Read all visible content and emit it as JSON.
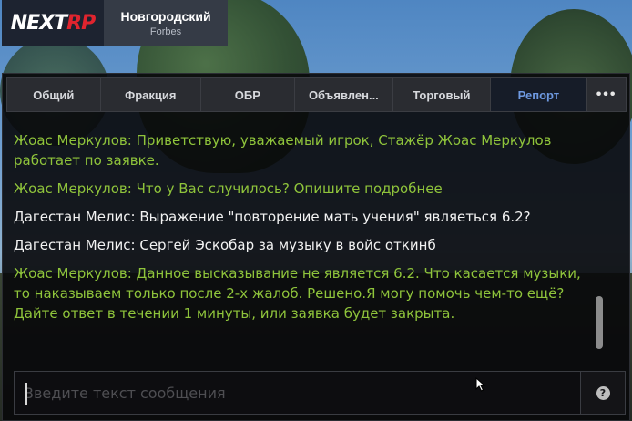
{
  "logo": {
    "part1": "NEXT",
    "part2": "RP"
  },
  "server": {
    "name": "Новгородский",
    "sub": "Forbes"
  },
  "tabs": [
    {
      "label": "Общий",
      "active": false
    },
    {
      "label": "Фракция",
      "active": false
    },
    {
      "label": "ОБР",
      "active": false
    },
    {
      "label": "Объявлен...",
      "active": false
    },
    {
      "label": "Торговый",
      "active": false
    },
    {
      "label": "Репорт",
      "active": true
    }
  ],
  "more_label": "•••",
  "messages": [
    {
      "text": "Жоас Меркулов: Приветствую, уважаемый игрок, Стажёр Жоас Меркулов работает по заявке.",
      "color": "green"
    },
    {
      "text": "Жоас Меркулов: Что у Вас случилось? Опишите подробнее",
      "color": "green"
    },
    {
      "text": "Дагестан Мелис: Выражение \"повторение мать учения\" являеться 6.2?",
      "color": "white"
    },
    {
      "text": "Дагестан Мелис: Сергей Эскобар за музыку в войс откинб",
      "color": "white"
    },
    {
      "text": "Жоас Меркулов: Данное высказывание не является 6.2. Что касается музыки, то наказываем только после 2-х жалоб. Решено.Я могу помочь чем-то ещё?Дайте ответ в течении 1 минуты, или заявка будет закрыта.",
      "color": "green"
    }
  ],
  "input": {
    "placeholder": "Введите текст сообщения",
    "value": ""
  },
  "help": {
    "label": "?"
  },
  "colors": {
    "green": "#8fc43b",
    "white": "#f2f2f2",
    "active_tab": "#6e99e0",
    "logo_red": "#e0242e"
  }
}
